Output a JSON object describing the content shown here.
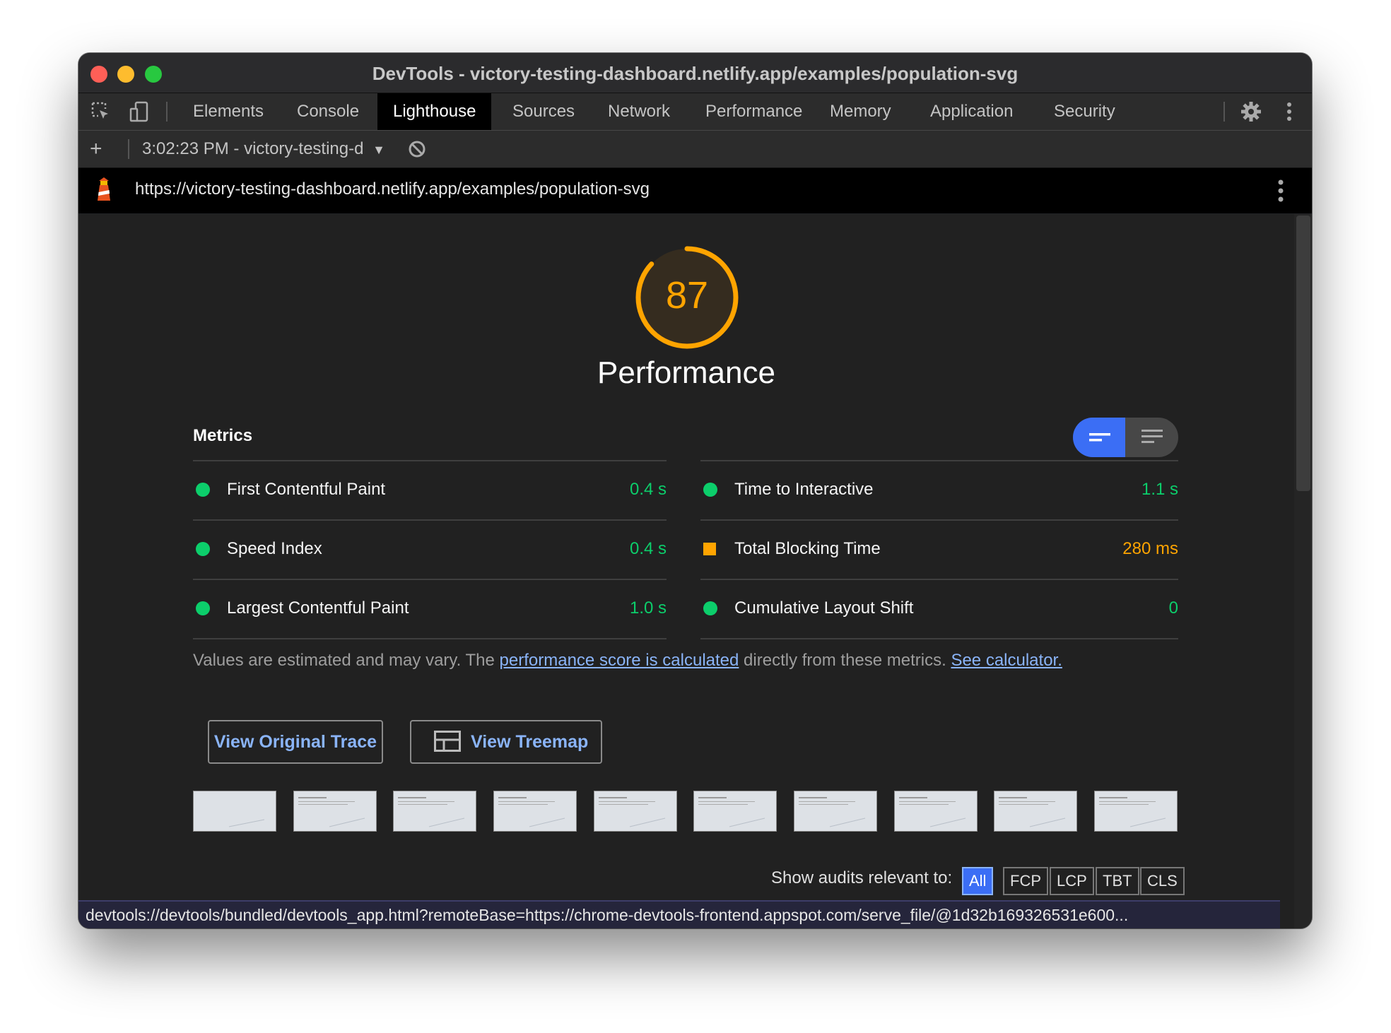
{
  "window": {
    "title": "DevTools - victory-testing-dashboard.netlify.app/examples/population-svg"
  },
  "tabs": [
    "Elements",
    "Console",
    "Lighthouse",
    "Sources",
    "Network",
    "Performance",
    "Memory",
    "Application",
    "Security"
  ],
  "active_tab": "Lighthouse",
  "toolbar": {
    "report_select": "3:02:23 PM - victory-testing-d"
  },
  "urlbar": {
    "url": "https://victory-testing-dashboard.netlify.app/examples/population-svg"
  },
  "gauge": {
    "score": "87",
    "category": "Performance",
    "color": "#ffa400"
  },
  "metrics": {
    "title": "Metrics",
    "left": [
      {
        "name": "First Contentful Paint",
        "value": "0.4 s",
        "status": "pass"
      },
      {
        "name": "Speed Index",
        "value": "0.4 s",
        "status": "pass"
      },
      {
        "name": "Largest Contentful Paint",
        "value": "1.0 s",
        "status": "pass"
      }
    ],
    "right": [
      {
        "name": "Time to Interactive",
        "value": "1.1 s",
        "status": "pass"
      },
      {
        "name": "Total Blocking Time",
        "value": "280 ms",
        "status": "average"
      },
      {
        "name": "Cumulative Layout Shift",
        "value": "0",
        "status": "pass"
      }
    ]
  },
  "note": {
    "prefix": "Values are estimated and may vary. The ",
    "link1": "performance score is calculated",
    "middle": " directly from these metrics. ",
    "link2": "See calculator."
  },
  "buttons": {
    "trace": "View Original Trace",
    "treemap": "View Treemap"
  },
  "audit_filter": {
    "label": "Show audits relevant to:",
    "chips": [
      "All",
      "FCP",
      "LCP",
      "TBT",
      "CLS"
    ],
    "active": "All"
  },
  "statusbar": {
    "text": "devtools://devtools/bundled/devtools_app.html?remoteBase=https://chrome-devtools-frontend.appspot.com/serve_file/@1d32b169326531e600..."
  },
  "colors": {
    "pass": "#0cce6b",
    "average": "#ffa400",
    "accent": "#3b6ef5",
    "link": "#8ab4f8"
  }
}
